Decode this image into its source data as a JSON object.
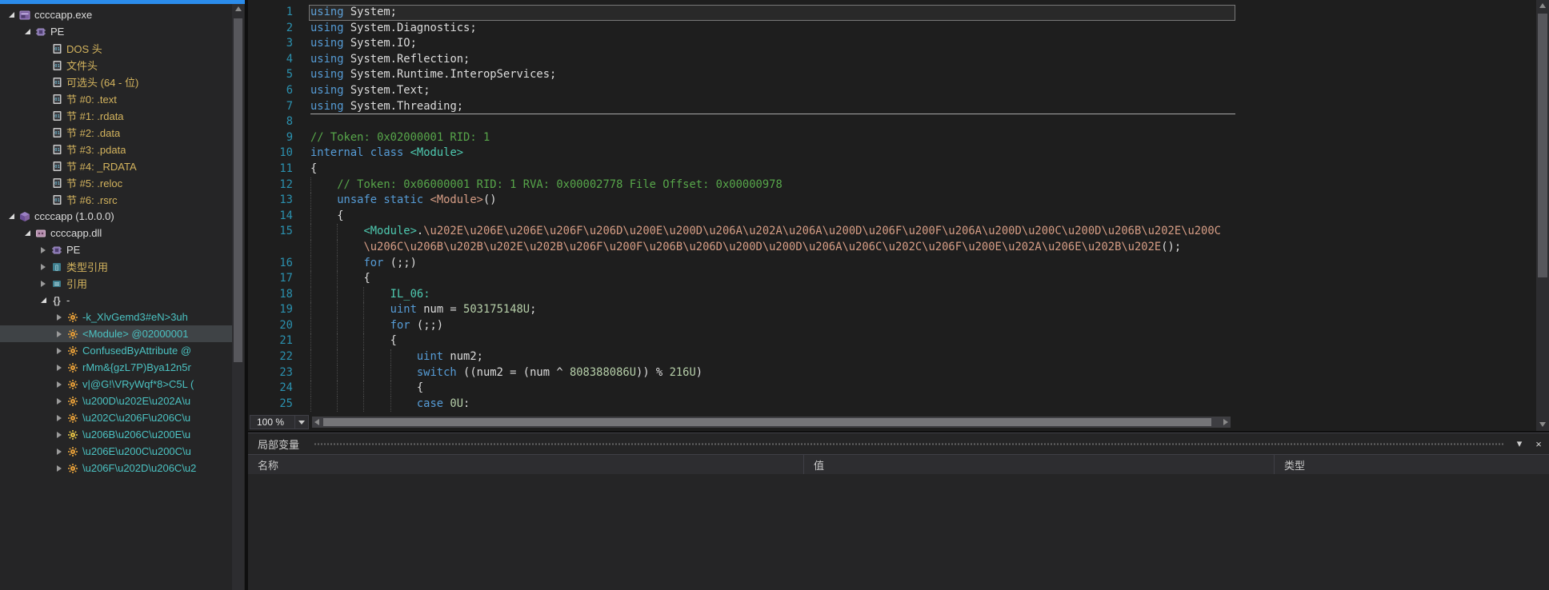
{
  "colors": {
    "accent": "#2B8CEB",
    "selection": "#3F4346",
    "line_number": "#2B91AF",
    "keyword": "#569CD6",
    "comment": "#57A64A",
    "number": "#B5CEA8",
    "type": "#4EC9B0",
    "method": "#D69D85",
    "tree_gold": "#D4B45E",
    "tree_teal": "#4BC2C2"
  },
  "tree": {
    "items": [
      {
        "label": "ccccapp.exe",
        "level": 0,
        "arrow": "expanded",
        "icon": "exe-icon",
        "color": "default",
        "selected": false
      },
      {
        "label": "PE",
        "level": 1,
        "arrow": "expanded",
        "icon": "pe-icon",
        "color": "default",
        "selected": false
      },
      {
        "label": "DOS 头",
        "level": 2,
        "arrow": "none",
        "icon": "binary-file-icon",
        "color": "gold",
        "selected": false
      },
      {
        "label": "文件头",
        "level": 2,
        "arrow": "none",
        "icon": "binary-file-icon",
        "color": "gold",
        "selected": false
      },
      {
        "label": "可选头 (64 - 位)",
        "level": 2,
        "arrow": "none",
        "icon": "binary-file-icon",
        "color": "gold",
        "selected": false
      },
      {
        "label": "节 #0: .text",
        "level": 2,
        "arrow": "none",
        "icon": "binary-file-icon",
        "color": "gold",
        "selected": false
      },
      {
        "label": "节 #1: .rdata",
        "level": 2,
        "arrow": "none",
        "icon": "binary-file-icon",
        "color": "gold",
        "selected": false
      },
      {
        "label": "节 #2: .data",
        "level": 2,
        "arrow": "none",
        "icon": "binary-file-icon",
        "color": "gold",
        "selected": false
      },
      {
        "label": "节 #3: .pdata",
        "level": 2,
        "arrow": "none",
        "icon": "binary-file-icon",
        "color": "gold",
        "selected": false
      },
      {
        "label": "节 #4: _RDATA",
        "level": 2,
        "arrow": "none",
        "icon": "binary-file-icon",
        "color": "gold",
        "selected": false
      },
      {
        "label": "节 #5: .reloc",
        "level": 2,
        "arrow": "none",
        "icon": "binary-file-icon",
        "color": "gold",
        "selected": false
      },
      {
        "label": "节 #6: .rsrc",
        "level": 2,
        "arrow": "none",
        "icon": "binary-file-icon",
        "color": "gold",
        "selected": false
      },
      {
        "label": "ccccapp (1.0.0.0)",
        "level": 0,
        "arrow": "expanded",
        "icon": "assembly-icon",
        "color": "default",
        "selected": false
      },
      {
        "label": "ccccapp.dll",
        "level": 1,
        "arrow": "expanded",
        "icon": "module-icon",
        "color": "default",
        "selected": false
      },
      {
        "label": "PE",
        "level": 2,
        "arrow": "collapsed",
        "icon": "pe-icon",
        "color": "default",
        "selected": false
      },
      {
        "label": "类型引用",
        "level": 2,
        "arrow": "collapsed",
        "icon": "type-references-icon",
        "color": "gold",
        "selected": false
      },
      {
        "label": "引用",
        "level": 2,
        "arrow": "collapsed",
        "icon": "references-icon",
        "color": "gold",
        "selected": false
      },
      {
        "label": "-",
        "level": 2,
        "arrow": "expanded",
        "icon": "namespace-icon",
        "color": "default",
        "selected": false
      },
      {
        "label": "-k_XlvGemd3#eN>3uh",
        "level": 3,
        "arrow": "collapsed",
        "icon": "class-icon",
        "color": "teal",
        "selected": false
      },
      {
        "label": "<Module> @02000001",
        "level": 3,
        "arrow": "collapsed",
        "icon": "class-icon",
        "color": "teal",
        "selected": true
      },
      {
        "label": "ConfusedByAttribute @",
        "level": 3,
        "arrow": "collapsed",
        "icon": "class-icon",
        "color": "teal",
        "selected": false
      },
      {
        "label": "rMm&{gzL7P)Bya12n5r",
        "level": 3,
        "arrow": "collapsed",
        "icon": "class-icon",
        "color": "teal",
        "selected": false
      },
      {
        "label": "v|@G!\\VRyWqf*8>C5L (",
        "level": 3,
        "arrow": "collapsed",
        "icon": "class-icon",
        "color": "teal",
        "selected": false
      },
      {
        "label": "\\u200D\\u202E\\u202A\\u",
        "level": 3,
        "arrow": "collapsed",
        "icon": "class-icon",
        "color": "teal",
        "selected": false
      },
      {
        "label": "\\u202C\\u206F\\u206C\\u",
        "level": 3,
        "arrow": "collapsed",
        "icon": "class-icon",
        "color": "teal",
        "selected": false
      },
      {
        "label": "\\u206B\\u206C\\u200E\\u",
        "level": 3,
        "arrow": "collapsed",
        "icon": "class-alt-icon",
        "color": "teal",
        "selected": false
      },
      {
        "label": "\\u206E\\u200C\\u200C\\u",
        "level": 3,
        "arrow": "collapsed",
        "icon": "class-icon",
        "color": "teal",
        "selected": false
      },
      {
        "label": "\\u206F\\u202D\\u206C\\u2",
        "level": 3,
        "arrow": "collapsed",
        "icon": "class-icon",
        "color": "teal",
        "selected": false
      }
    ]
  },
  "editor": {
    "zoom": "100 %",
    "lines": [
      {
        "n": "1",
        "ind": 0,
        "hl": true,
        "tok": [
          [
            "k",
            "using "
          ],
          [
            "d",
            "System;"
          ]
        ]
      },
      {
        "n": "2",
        "ind": 0,
        "tok": [
          [
            "k",
            "using "
          ],
          [
            "d",
            "System.Diagnostics;"
          ]
        ]
      },
      {
        "n": "3",
        "ind": 0,
        "tok": [
          [
            "k",
            "using "
          ],
          [
            "d",
            "System.IO;"
          ]
        ]
      },
      {
        "n": "4",
        "ind": 0,
        "tok": [
          [
            "k",
            "using "
          ],
          [
            "d",
            "System.Reflection;"
          ]
        ]
      },
      {
        "n": "5",
        "ind": 0,
        "tok": [
          [
            "k",
            "using "
          ],
          [
            "d",
            "System.Runtime.InteropServices;"
          ]
        ]
      },
      {
        "n": "6",
        "ind": 0,
        "tok": [
          [
            "k",
            "using "
          ],
          [
            "d",
            "System.Text;"
          ]
        ]
      },
      {
        "n": "7",
        "ind": 0,
        "sep": true,
        "tok": [
          [
            "k",
            "using "
          ],
          [
            "d",
            "System.Threading;"
          ]
        ]
      },
      {
        "n": "8",
        "ind": 0,
        "tok": []
      },
      {
        "n": "9",
        "ind": 0,
        "tok": [
          [
            "c",
            "// Token: 0x02000001 RID: 1"
          ]
        ]
      },
      {
        "n": "10",
        "ind": 0,
        "tok": [
          [
            "k",
            "internal class "
          ],
          [
            "ty",
            "<Module>"
          ]
        ]
      },
      {
        "n": "11",
        "ind": 0,
        "tok": [
          [
            "d",
            "{"
          ]
        ]
      },
      {
        "n": "12",
        "ind": 1,
        "tok": [
          [
            "c",
            "// Token: 0x06000001 RID: 1 RVA: 0x00002778 File Offset: 0x00000978"
          ]
        ]
      },
      {
        "n": "13",
        "ind": 1,
        "tok": [
          [
            "k",
            "unsafe static "
          ],
          [
            "m",
            "<Module>"
          ],
          [
            "d",
            "()"
          ]
        ]
      },
      {
        "n": "14",
        "ind": 1,
        "tok": [
          [
            "d",
            "{"
          ]
        ]
      },
      {
        "n": "15",
        "ind": 2,
        "tok": [
          [
            "ty",
            "<Module>"
          ],
          [
            "d",
            "."
          ],
          [
            "m",
            "\\u202E\\u206E\\u206E\\u206F\\u206D\\u200E\\u200D\\u206A\\u202A\\u206A\\u200D\\u206F\\u200F\\u206A\\u200D\\u200C\\u200D\\u206B\\u202E\\u200C"
          ]
        ]
      },
      {
        "n": "",
        "ind": 2,
        "tok": [
          [
            "m",
            "\\u206C\\u206B\\u202B\\u202E\\u202B\\u206F\\u200F\\u206B\\u206D\\u200D\\u200D\\u206A\\u206C\\u202C\\u206F\\u200E\\u202A\\u206E\\u202B\\u202E"
          ],
          [
            "d",
            "();"
          ]
        ]
      },
      {
        "n": "16",
        "ind": 2,
        "tok": [
          [
            "k",
            "for "
          ],
          [
            "d",
            "(;;)"
          ]
        ]
      },
      {
        "n": "17",
        "ind": 2,
        "tok": [
          [
            "d",
            "{"
          ]
        ]
      },
      {
        "n": "18",
        "ind": 3,
        "tok": [
          [
            "lbl",
            "IL_06:"
          ]
        ]
      },
      {
        "n": "19",
        "ind": 3,
        "tok": [
          [
            "k",
            "uint "
          ],
          [
            "d",
            "num = "
          ],
          [
            "n",
            "503175148U"
          ],
          [
            "d",
            ";"
          ]
        ]
      },
      {
        "n": "20",
        "ind": 3,
        "tok": [
          [
            "k",
            "for "
          ],
          [
            "d",
            "(;;)"
          ]
        ]
      },
      {
        "n": "21",
        "ind": 3,
        "tok": [
          [
            "d",
            "{"
          ]
        ]
      },
      {
        "n": "22",
        "ind": 4,
        "tok": [
          [
            "k",
            "uint "
          ],
          [
            "d",
            "num2;"
          ]
        ]
      },
      {
        "n": "23",
        "ind": 4,
        "tok": [
          [
            "k",
            "switch "
          ],
          [
            "d",
            "((num2 = (num ^ "
          ],
          [
            "n",
            "808388086U"
          ],
          [
            "d",
            ")) % "
          ],
          [
            "n",
            "216U"
          ],
          [
            "d",
            ")"
          ]
        ]
      },
      {
        "n": "24",
        "ind": 4,
        "tok": [
          [
            "d",
            "{"
          ]
        ]
      },
      {
        "n": "25",
        "ind": 4,
        "tok": [
          [
            "k",
            "case "
          ],
          [
            "n",
            "0U"
          ],
          [
            "d",
            ":"
          ]
        ]
      }
    ]
  },
  "locals": {
    "title": "局部变量",
    "columns": [
      "名称",
      "值",
      "类型"
    ],
    "rows": []
  }
}
